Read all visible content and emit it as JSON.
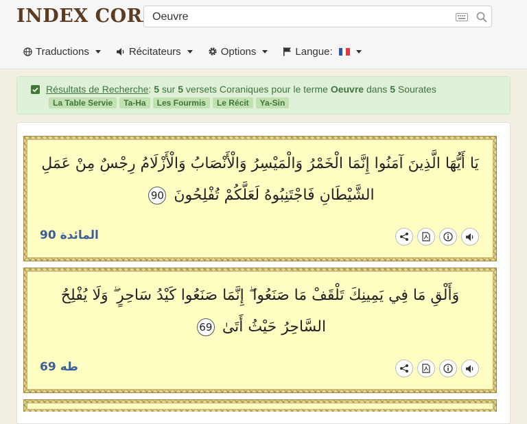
{
  "app": {
    "logo_text": "INDEX CORAN"
  },
  "search": {
    "value": "Oeuvre",
    "placeholder": "",
    "icons": [
      "keyboard-icon",
      "search-icon"
    ]
  },
  "nav": {
    "translations": "Traductions",
    "reciters": "Récitateurs",
    "options": "Options",
    "language": "Langue:"
  },
  "results": {
    "link": "Résultats de Recherche",
    "sep": ":",
    "count": "5",
    "word_sur": "sur",
    "total": "5",
    "middle": "versets Coraniques pour le terme",
    "term": "Oeuvre",
    "word_dans": "dans",
    "sourates_count": "5",
    "word_sourates": "Sourates",
    "tags": [
      "La Table Servie",
      "Ta-Ha",
      "Les Fourmis",
      "Le Récit",
      "Ya-Sin"
    ]
  },
  "verses": [
    {
      "text": "يَا أَيُّهَا الَّذِينَ آمَنُوا إِنَّمَا الْخَمْرُ وَالْمَيْسِرُ وَالْأَنْصَابُ وَالْأَزْلَامُ رِجْسٌ مِنْ عَمَلِ الشَّيْطَانِ فَاجْتَنِبُوهُ لَعَلَّكُمْ تُفْلِحُونَ",
      "number": "90",
      "sura_name": "المائدة",
      "sura_ref": "90"
    },
    {
      "text": "وَأَلْقِ مَا فِي يَمِينِكَ تَلْقَفْ مَا صَنَعُوا ۖ إِنَّمَا صَنَعُوا كَيْدُ سَاحِرٍ ۖ وَلَا يُفْلِحُ السَّاحِرُ حَيْثُ أَتَىٰ",
      "number": "69",
      "sura_name": "طه",
      "sura_ref": "69"
    }
  ],
  "action_icons": [
    "share-icon",
    "pdf-icon",
    "info-icon",
    "audio-icon"
  ],
  "colors": {
    "header_bg": "#f6f6f6",
    "logo": "#5a3c22",
    "alert_bg": "#dff0d8",
    "alert_text": "#3c763d",
    "verse_bg": "#fefdc2",
    "ref_text": "#3b5e9b"
  }
}
